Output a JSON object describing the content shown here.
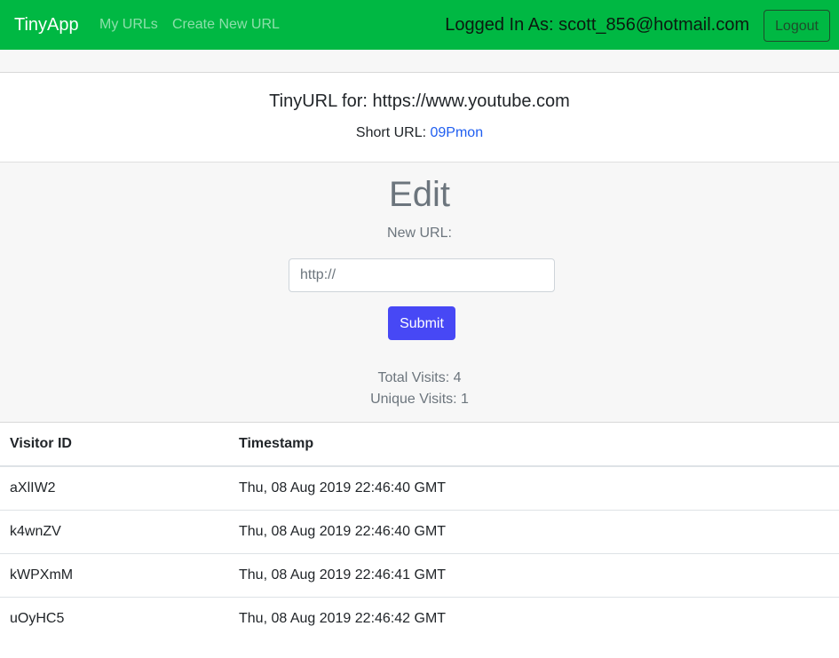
{
  "navbar": {
    "brand": "TinyApp",
    "links": [
      "My URLs",
      "Create New URL"
    ],
    "logged_in_text": "Logged In As: scott_856@hotmail.com",
    "logout_label": "Logout",
    "bg_color": "#00b843"
  },
  "url_card": {
    "title": "TinyURL for: https://www.youtube.com",
    "short_url_label": "Short URL: ",
    "short_url_value": "09Pmon"
  },
  "edit": {
    "heading": "Edit",
    "field_label": "New URL:",
    "placeholder": "http://",
    "submit_label": "Submit",
    "submit_color": "#4748f5"
  },
  "stats": {
    "total_visits": "Total Visits: 4",
    "unique_visits": "Unique Visits: 1"
  },
  "visits_table": {
    "columns": [
      "Visitor ID",
      "Timestamp"
    ],
    "rows": [
      [
        "aXlIW2",
        "Thu, 08 Aug 2019 22:46:40 GMT"
      ],
      [
        "k4wnZV",
        "Thu, 08 Aug 2019 22:46:40 GMT"
      ],
      [
        "kWPXmM",
        "Thu, 08 Aug 2019 22:46:41 GMT"
      ],
      [
        "uOyHC5",
        "Thu, 08 Aug 2019 22:46:42 GMT"
      ]
    ]
  }
}
